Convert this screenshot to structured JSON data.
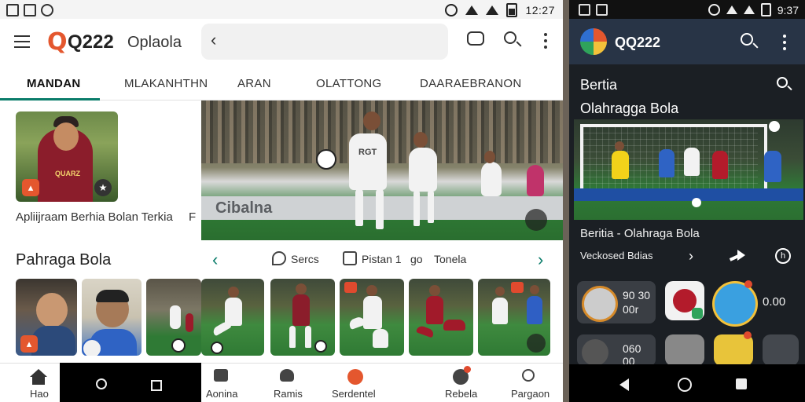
{
  "left": {
    "status_time": "12:27",
    "app": {
      "logo_q": "Q",
      "title": "Q222",
      "subtitle": "Oplaola"
    },
    "tabs": [
      "MANDAN",
      "MLAKANHTHN",
      "ARAN",
      "OLATTONG",
      "DAARAEBRANON"
    ],
    "card": {
      "caption": "Apliijraam Berhia Bolan Terkia",
      "badge": "F"
    },
    "section_title": "Pahraga Bola",
    "hero_board": "Cibalna",
    "hero_jersey": "RGT",
    "actions": {
      "a1": "Sercs",
      "a2": "Pistan 1",
      "a3_icon": "go",
      "a3": "Tonela"
    },
    "nav": {
      "home": "Hao",
      "n2": "Aonina",
      "n3": "Ramis",
      "n4": "Serdentel",
      "n5": "Rebela",
      "n6": "Pargaon"
    },
    "shirt_text": "QUARZ"
  },
  "right": {
    "status_time": "9:37",
    "app_title": "QQ222",
    "section1": "Bertia",
    "section2": "Olahragga Bola",
    "caption": "Beritia - Olahraga Bola",
    "subcaption": "Veckosed Bdias",
    "info_icon": "h",
    "card1_line1": "90 30",
    "card1_line2": "00r",
    "card_value": "0.00",
    "card2_text": "060 00"
  },
  "colors": {
    "accent": "#0a7c6a",
    "brand": "#e4572e",
    "right_bar": "#283446"
  }
}
